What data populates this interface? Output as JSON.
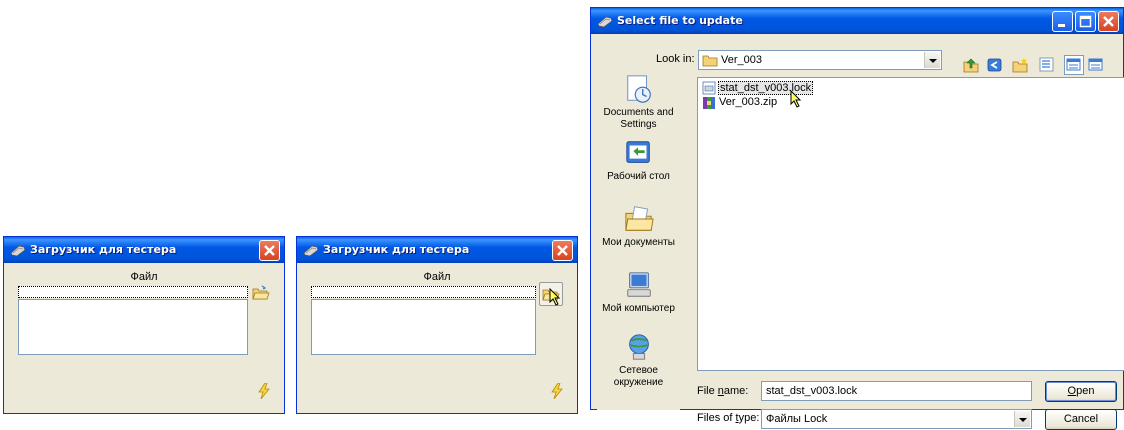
{
  "loader_window_1": {
    "title": "Загрузчик для тестера",
    "file_label": "Файл",
    "file_value": ""
  },
  "loader_window_2": {
    "title": "Загрузчик для тестера",
    "file_label": "Файл",
    "file_value": ""
  },
  "file_dialog": {
    "title": "Select file to update",
    "look_in_label": "Look in:",
    "look_in_value": "Ver_003",
    "places": [
      {
        "label": "Documents and Settings",
        "icon": "documents-and-settings-icon"
      },
      {
        "label": "Рабочий стол",
        "icon": "desktop-icon"
      },
      {
        "label": "Мои документы",
        "icon": "my-documents-icon"
      },
      {
        "label": "Мой компьютер",
        "icon": "my-computer-icon"
      },
      {
        "label": "Сетевое окружение",
        "icon": "network-icon"
      }
    ],
    "files": [
      {
        "name": "stat_dst_v003.lock",
        "icon": "lock-file-icon",
        "selected": true
      },
      {
        "name": "Ver_003.zip",
        "icon": "zip-file-icon",
        "selected": false
      }
    ],
    "file_name_label": "File name:",
    "file_name_value": "stat_dst_v003.lock",
    "files_of_type_label": "Files of type:",
    "files_of_type_value": "Файлы Lock",
    "open_button": "Open",
    "cancel_button": "Cancel"
  }
}
